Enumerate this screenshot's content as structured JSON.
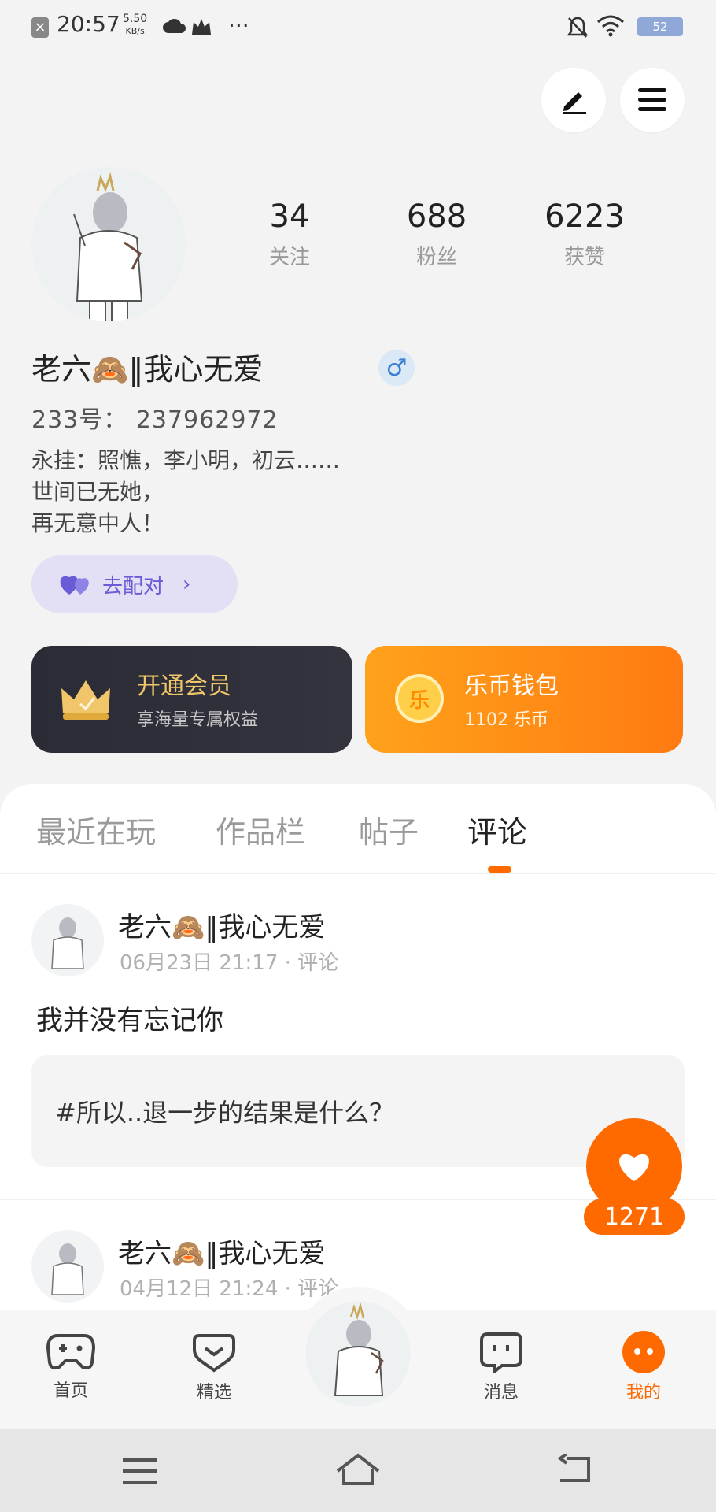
{
  "status_bar": {
    "time": "20:57",
    "speed_value": "5.50",
    "speed_unit": "KB/s",
    "more": "···",
    "battery": "52"
  },
  "header": {
    "edit_icon": "pencil-icon",
    "menu_icon": "menu-icon"
  },
  "stats": [
    {
      "value": "34",
      "label": "关注"
    },
    {
      "value": "688",
      "label": "粉丝"
    },
    {
      "value": "6223",
      "label": "获赞"
    }
  ],
  "profile": {
    "name": "老六🙈‖我心无爱",
    "gender_symbol": "♂",
    "uid": "233号： 237962972",
    "bio": "永挂：照憔，李小明，初云……\n世间已无她，\n再无意中人！",
    "pair_button": "去配对",
    "pair_chevron": "›"
  },
  "cards": {
    "vip": {
      "title": "开通会员",
      "subtitle": "享海量专属权益"
    },
    "wallet": {
      "title": "乐币钱包",
      "subtitle": "1102 乐币",
      "coin_char": "乐"
    }
  },
  "tabs": [
    {
      "label": "最近在玩",
      "active": false
    },
    {
      "label": "作品栏",
      "active": false
    },
    {
      "label": "帖子",
      "active": false
    },
    {
      "label": "评论",
      "active": true
    }
  ],
  "posts": [
    {
      "name": "老六🙈‖我心无爱",
      "meta": "06月23日 21:17 · 评论",
      "text": "我并没有忘记你",
      "quote": "#所以..退一步的结果是什么？"
    },
    {
      "name": "老六🙈‖我心无爱",
      "meta": "04月12日 21:24 · 评论"
    }
  ],
  "like": {
    "count": "1271"
  },
  "bottom_nav": [
    {
      "label": "首页",
      "icon": "gamepad-icon",
      "active": false
    },
    {
      "label": "精选",
      "icon": "heart-badge-icon",
      "active": false
    },
    {
      "label": "消息",
      "icon": "chat-icon",
      "active": false
    },
    {
      "label": "我的",
      "icon": "face-icon",
      "active": true
    }
  ],
  "colors": {
    "accent": "#ff6a00",
    "pair_purple": "#6a5bd7",
    "vip_gold": "#f1c66a"
  }
}
